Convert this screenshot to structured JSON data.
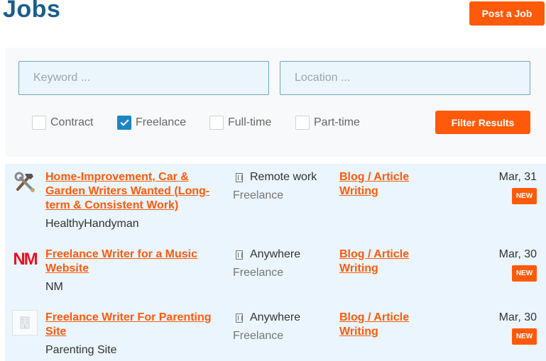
{
  "header": {
    "title": "Jobs",
    "post_job_label": "Post a Job"
  },
  "filters": {
    "keyword_placeholder": "Keyword ...",
    "location_placeholder": "Location ...",
    "job_types": [
      {
        "label": "Contract",
        "checked": false
      },
      {
        "label": "Freelance",
        "checked": true
      },
      {
        "label": "Full-time",
        "checked": false
      },
      {
        "label": "Part-time",
        "checked": false
      }
    ],
    "submit_label": "Filter Results"
  },
  "jobs": [
    {
      "title": "Home-Improvement, Car & Garden Writers Wanted (Long-term & Consistent Work)",
      "company": "HealthyHandyman",
      "location": "Remote work",
      "type": "Freelance",
      "category": "Blog / Article Writing",
      "date": "Mar, 31",
      "badge": "NEW",
      "logo_icon": "hammer-wrench-icon"
    },
    {
      "title": "Freelance Writer for a Music Website",
      "company": "NM",
      "location": "Anywhere",
      "type": "Freelance",
      "category": "Blog / Article Writing",
      "date": "Mar, 30",
      "badge": "NEW",
      "logo_text": "NM"
    },
    {
      "title": "Freelance Writer For Parenting Site",
      "company": "Parenting Site",
      "location": "Anywhere",
      "type": "Freelance",
      "category": "Blog / Article Writing",
      "date": "Mar, 30",
      "badge": "NEW",
      "logo_icon": "building-placeholder-icon"
    }
  ],
  "colors": {
    "brand_blue": "#1a5e8a",
    "accent_orange": "#ff5a0a",
    "list_background": "#eaf5fd"
  }
}
